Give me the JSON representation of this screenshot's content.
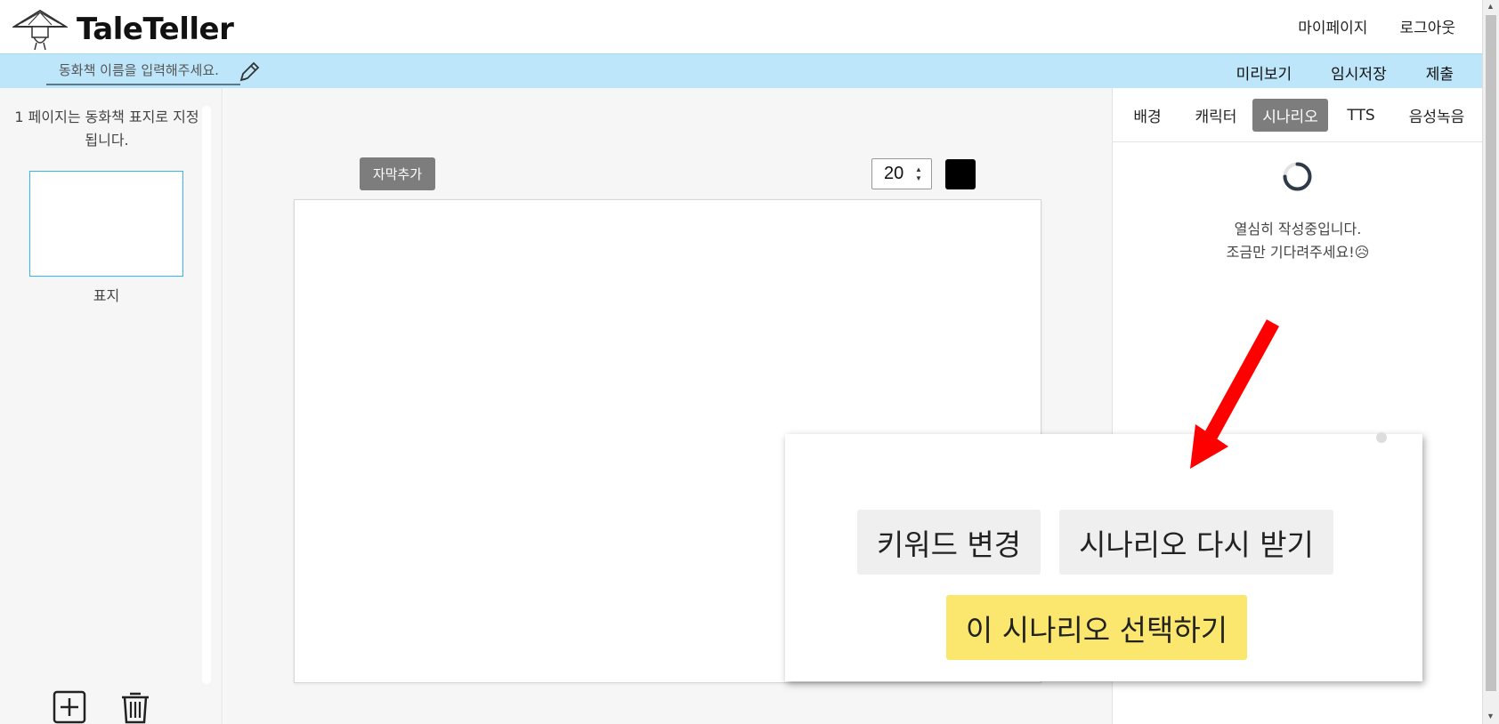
{
  "header": {
    "logo_text": "TaleTeller",
    "nav": {
      "mypage": "마이페이지",
      "logout": "로그아웃"
    }
  },
  "toolbar": {
    "title_placeholder": "동화책 이름을 입력해주세요.",
    "preview": "미리보기",
    "temp_save": "임시저장",
    "submit": "제출"
  },
  "left_panel": {
    "note": "1 페이지는 동화책 표지로 지정됩니다.",
    "pages": [
      {
        "label": "표지"
      }
    ]
  },
  "editor": {
    "add_subtitle": "자막추가",
    "font_size": "20",
    "text_color": "#000000"
  },
  "right_panel": {
    "tabs": [
      "배경",
      "캐릭터",
      "시나리오",
      "TTS",
      "음성녹음"
    ],
    "active_tab": "시나리오",
    "loading_line1": "열심히 작성중입니다.",
    "loading_line2": "조금만 기다려주세요!😥"
  },
  "popup": {
    "change_keyword": "키워드 변경",
    "regenerate": "시나리오 다시 받기",
    "select": "이 시나리오 선택하기"
  },
  "colors": {
    "toolbar_bg": "#bde6fa",
    "active_tab": "#7d7d7d",
    "select_button": "#fbe76e",
    "page_thumb_border": "#37b6ea",
    "annotation_arrow": "#ff0000"
  }
}
